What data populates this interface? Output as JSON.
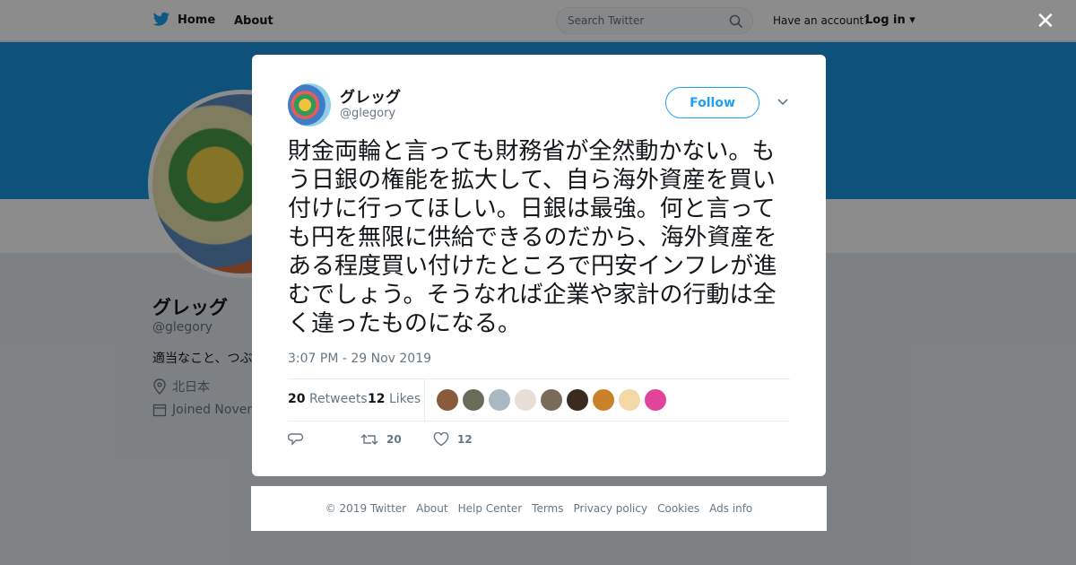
{
  "nav": {
    "home_label": "Home",
    "about_label": "About",
    "search_placeholder": "Search Twitter",
    "account_prompt": "Have an account?",
    "login_label": "Log in"
  },
  "profile": {
    "name": "グレッグ",
    "handle": "@glegory",
    "bio": "適当なこと、つぶ",
    "location": "北日本",
    "joined": "Joined Novem"
  },
  "modal": {
    "close_label": "✕",
    "user": {
      "name": "グレッグ",
      "handle": "@glegory"
    },
    "follow_label": "Follow",
    "tweet_text": "財金両輪と言っても財務省が全然動かない。もう日銀の権能を拡大して、自ら海外資産を買い付けに行ってほしい。日銀は最強。何と言っても円を無限に供給できるのだから、海外資産をある程度買い付けたところで円安インフレが進むでしょう。そうなれば企業や家計の行動は全く違ったものになる。",
    "timestamp": "3:07 PM - 29 Nov 2019",
    "stats": {
      "retweets_count": "20",
      "retweets_label": "Retweets",
      "likes_count": "12",
      "likes_label": "Likes"
    },
    "likers": [
      {
        "color": "#8a5a3c"
      },
      {
        "color": "#6b6b5a"
      },
      {
        "color": "#aab8c2"
      },
      {
        "color": "#e8e0d8"
      },
      {
        "color": "#7a6a5a"
      },
      {
        "color": "#3a2a20"
      },
      {
        "color": "#c9822a"
      },
      {
        "color": "#f2d9a6"
      },
      {
        "color": "#e0459a"
      }
    ],
    "actions": {
      "retweet_count": "20",
      "like_count": "12"
    }
  },
  "footer": {
    "links": [
      "© 2019 Twitter",
      "About",
      "Help Center",
      "Terms",
      "Privacy policy",
      "Cookies",
      "Ads info"
    ]
  },
  "colors": {
    "brand": "#1da1f2",
    "banner": "#1b95e0"
  }
}
